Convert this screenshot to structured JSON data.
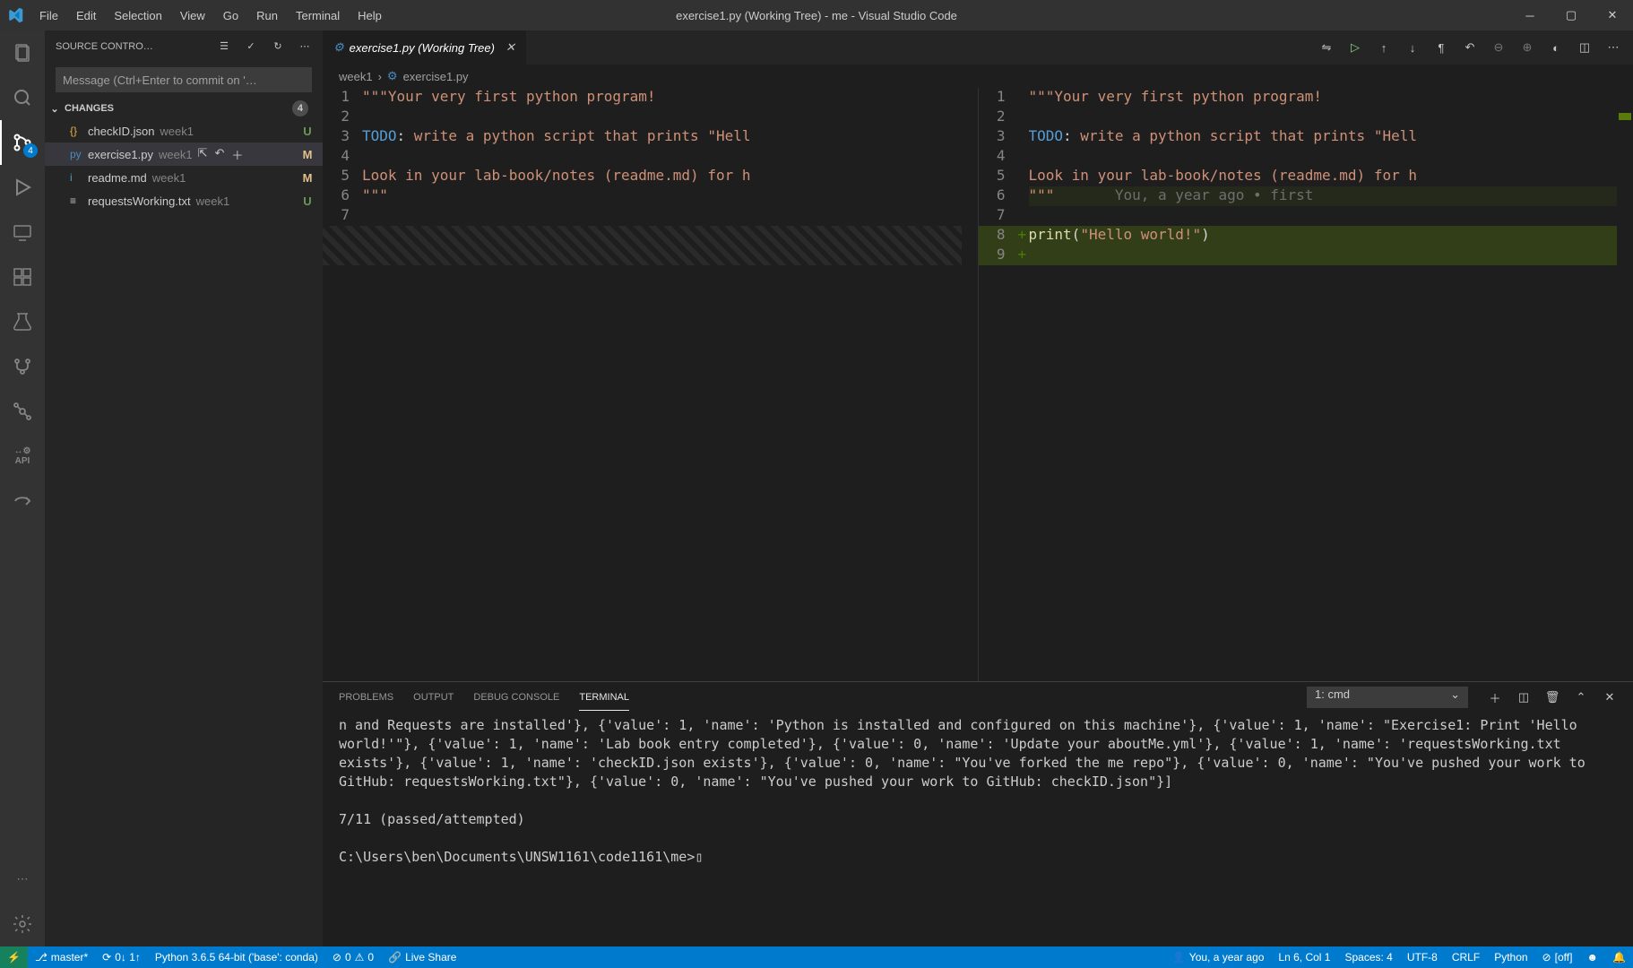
{
  "window": {
    "title": "exercise1.py (Working Tree) - me - Visual Studio Code"
  },
  "menu": [
    "File",
    "Edit",
    "Selection",
    "View",
    "Go",
    "Run",
    "Terminal",
    "Help"
  ],
  "activity": {
    "scm_badge": "4",
    "api_label": "API"
  },
  "sidebar": {
    "title": "SOURCE CONTRO…",
    "commit_placeholder": "Message (Ctrl+Enter to commit on '…",
    "changes_label": "CHANGES",
    "changes_count": "4",
    "files": [
      {
        "icon": "{}",
        "name": "checkID.json",
        "path": "week1",
        "status": "U"
      },
      {
        "icon": "py",
        "name": "exercise1.py",
        "path": "week1",
        "status": "M",
        "selected": true
      },
      {
        "icon": "i",
        "name": "readme.md",
        "path": "week1",
        "status": "M"
      },
      {
        "icon": "≡",
        "name": "requestsWorking.txt",
        "path": "week1",
        "status": "U"
      }
    ]
  },
  "tab": {
    "label": "exercise1.py (Working Tree)"
  },
  "breadcrumbs": {
    "part1": "week1",
    "part2": "exercise1.py"
  },
  "diff": {
    "left_lines": [
      {
        "n": "1",
        "html": "<span class='str'>\"\"\"Your very first python program!</span>"
      },
      {
        "n": "2",
        "html": ""
      },
      {
        "n": "3",
        "html": "<span class='kw'>TODO</span><span class='punc'>:</span><span class='str'> write a python script that prints \"Hell</span>"
      },
      {
        "n": "4",
        "html": ""
      },
      {
        "n": "5",
        "html": "<span class='str'>Look in your lab-book/notes (readme.md) for h</span>"
      },
      {
        "n": "6",
        "html": "<span class='str'>\"\"\"</span>"
      },
      {
        "n": "7",
        "html": ""
      }
    ],
    "right_lines": [
      {
        "n": "1",
        "html": "<span class='str'>\"\"\"Your very first python program!</span>"
      },
      {
        "n": "2",
        "html": ""
      },
      {
        "n": "3",
        "html": "<span class='kw'>TODO</span><span class='punc'>:</span><span class='str'> write a python script that prints \"Hell</span>"
      },
      {
        "n": "4",
        "html": ""
      },
      {
        "n": "5",
        "html": "<span class='str'>Look in your lab-book/notes (readme.md) for h</span>"
      },
      {
        "n": "6",
        "html": "<span class='str'>\"\"\"</span>       <span class='ghost'>You, a year ago • first</span>",
        "hl": true
      },
      {
        "n": "7",
        "html": ""
      },
      {
        "n": "8",
        "plus": "+",
        "html": "<span class='fn'>print</span><span class='punc'>(</span><span class='str'>\"Hello world!\"</span><span class='punc'>)</span>",
        "added": true
      },
      {
        "n": "9",
        "plus": "+",
        "html": "",
        "added": true
      }
    ]
  },
  "panel": {
    "tabs": [
      "PROBLEMS",
      "OUTPUT",
      "DEBUG CONSOLE",
      "TERMINAL"
    ],
    "active_tab": 3,
    "select_label": "1: cmd",
    "terminal_text": "n and Requests are installed'}, {'value': 1, 'name': 'Python is installed and configured on this machine'}, {'value': 1, 'name': \"Exercise1: Print 'Hello world!'\"}, {'value': 1, 'name': 'Lab book entry completed'}, {'value': 0, 'name': 'Update your aboutMe.yml'}, {'value': 1, 'name': 'requestsWorking.txt exists'}, {'value': 1, 'name': 'checkID.json exists'}, {'value': 0, 'name': \"You've forked the me repo\"}, {'value': 0, 'name': \"You've pushed your work to GitHub: requestsWorking.txt\"}, {'value': 0, 'name': \"You've pushed your work to GitHub: checkID.json\"}]\n\n7/11 (passed/attempted)\n\nC:\\Users\\ben\\Documents\\UNSW1161\\code1161\\me>▯"
  },
  "statusbar": {
    "branch": "master*",
    "sync": "0↓ 1↑",
    "python": "Python 3.6.5 64-bit ('base': conda)",
    "errors": "0",
    "warnings": "0",
    "liveshare": "Live Share",
    "blame": "You, a year ago",
    "cursor": "Ln 6, Col 1",
    "spaces": "Spaces: 4",
    "encoding": "UTF-8",
    "eol": "CRLF",
    "lang": "Python",
    "prettier": "[off]"
  }
}
